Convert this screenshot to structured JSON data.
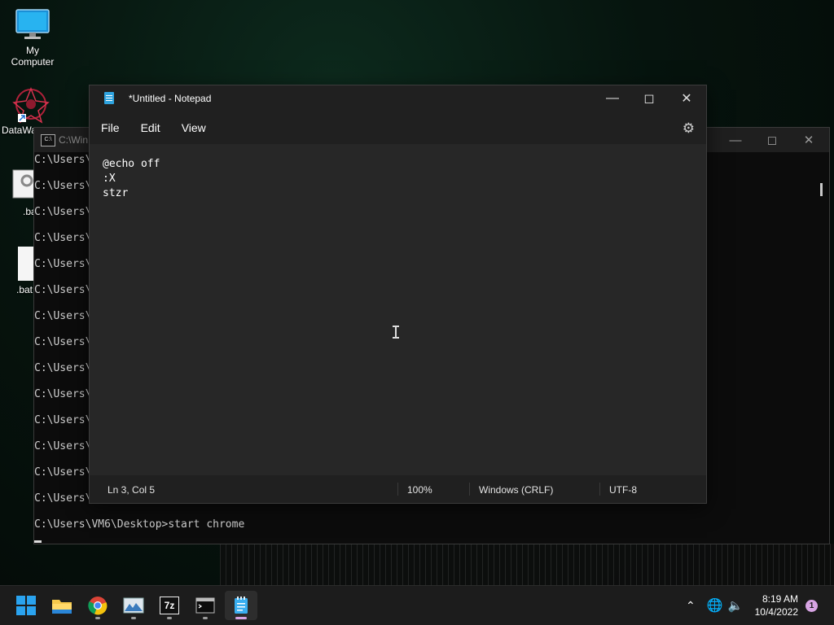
{
  "desktop": {
    "icons": [
      {
        "label": "My Computer"
      },
      {
        "label": "DataWa"
      },
      {
        "label": ".ba"
      },
      {
        "label": ".bat"
      }
    ]
  },
  "cmd": {
    "title": "C:\\Win",
    "lines": [
      "C:\\Users\\",
      "C:\\Users\\",
      "C:\\Users\\",
      "C:\\Users\\",
      "C:\\Users\\",
      "C:\\Users\\",
      "C:\\Users\\",
      "C:\\Users\\",
      "C:\\Users\\",
      "C:\\Users\\",
      "C:\\Users\\",
      "C:\\Users\\",
      "C:\\Users\\",
      "C:\\Users\\"
    ],
    "last_line": "C:\\Users\\VM6\\Desktop>start chrome"
  },
  "notepad": {
    "title": "*Untitled - Notepad",
    "menu": [
      "File",
      "Edit",
      "View"
    ],
    "content": "@echo off\n:X\nstzr",
    "status": {
      "position": "Ln 3, Col 5",
      "zoom": "100%",
      "line_ending": "Windows (CRLF)",
      "encoding": "UTF-8"
    }
  },
  "taskbar": {
    "apps": [
      "start-icon",
      "file-explorer-icon",
      "chrome-icon",
      "photos-icon",
      "7zip-icon",
      "terminal-icon",
      "notepad-icon"
    ],
    "seven_zip_label": "7z",
    "time": "8:19 AM",
    "date": "10/4/2022",
    "notification_count": "1"
  },
  "colors": {
    "accent": "#d7a4e3",
    "notepad_bg": "#272727"
  }
}
